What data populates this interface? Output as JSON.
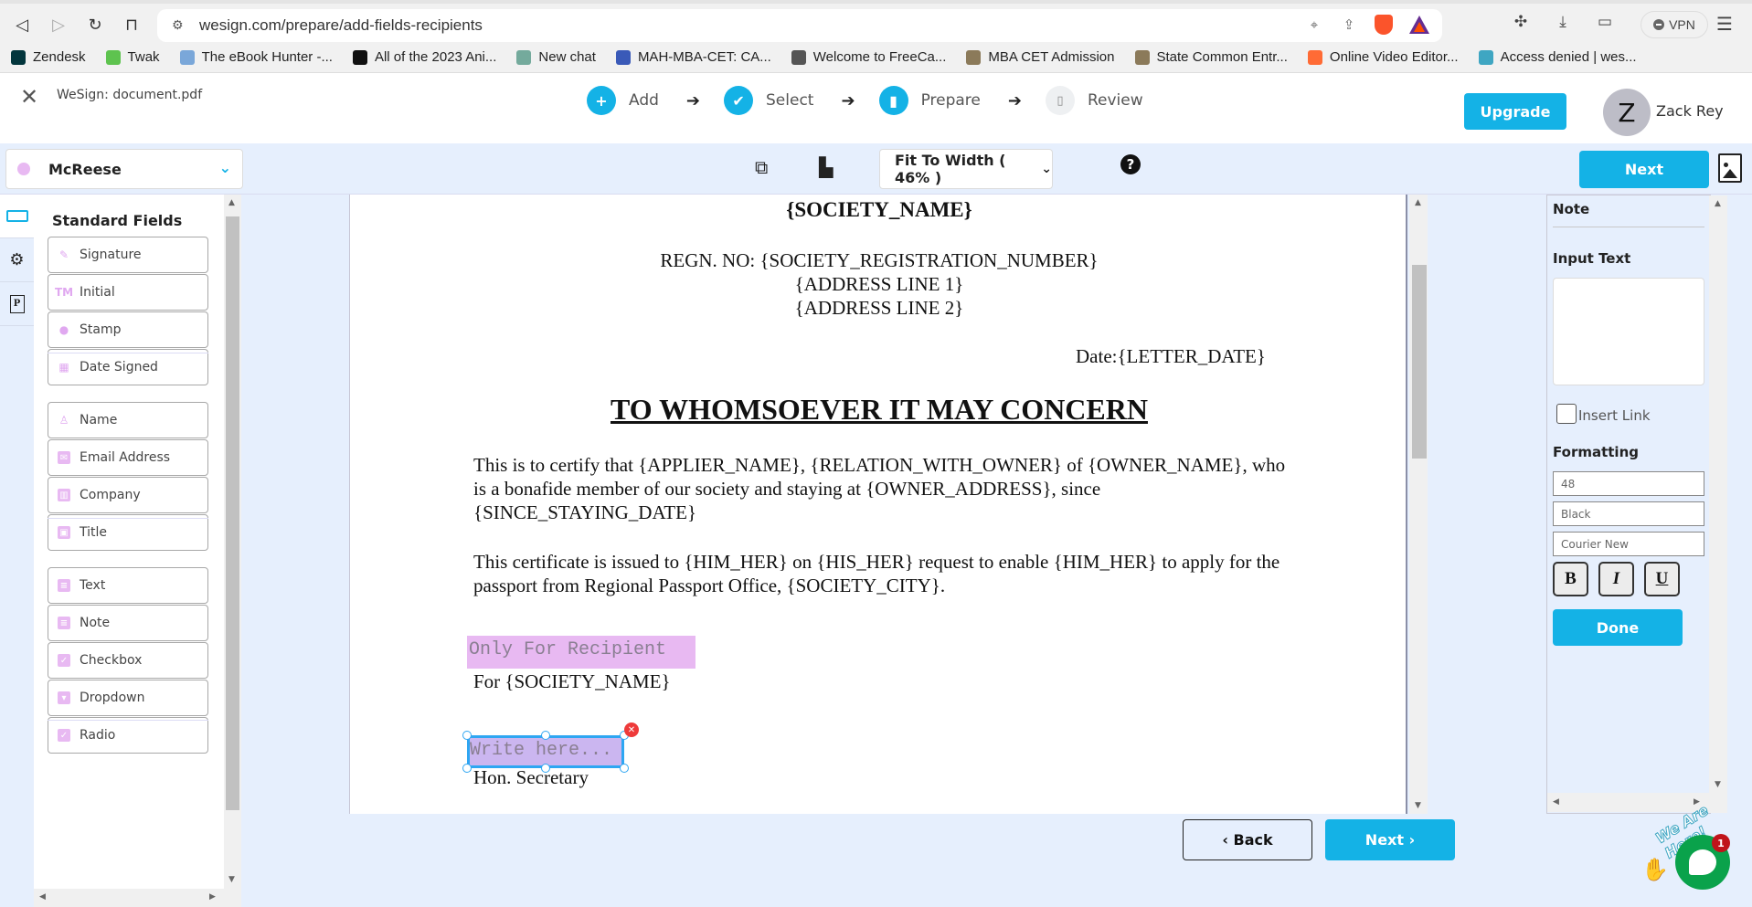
{
  "browser": {
    "url": "wesign.com/prepare/add-fields-recipients",
    "vpn_label": "VPN",
    "bookmarks": [
      {
        "label": "Zendesk",
        "color": "#03363d"
      },
      {
        "label": "Twak",
        "color": "#5ec34f"
      },
      {
        "label": "The eBook Hunter -...",
        "color": "#7aa7d9"
      },
      {
        "label": "All of the 2023 Ani...",
        "color": "#111111"
      },
      {
        "label": "New chat",
        "color": "#74aa9c"
      },
      {
        "label": "MAH-MBA-CET: CA...",
        "color": "#3a5ab8"
      },
      {
        "label": "Welcome to FreeCa...",
        "color": "#555555"
      },
      {
        "label": "MBA CET Admission",
        "color": "#8b7a5a"
      },
      {
        "label": "State Common Entr...",
        "color": "#8b7a5a"
      },
      {
        "label": "Online Video Editor...",
        "color": "#ff6b35"
      },
      {
        "label": "Access denied | wes...",
        "color": "#3fa6c2"
      }
    ]
  },
  "header": {
    "doc_title": "WeSign: document.pdf",
    "steps": [
      {
        "label": "Add",
        "icon": "plus-circle-icon",
        "glyph": "+",
        "state": "done"
      },
      {
        "label": "Select",
        "icon": "check-circle-icon",
        "glyph": "✔",
        "state": "done"
      },
      {
        "label": "Prepare",
        "icon": "file-icon",
        "glyph": "▮",
        "state": "active"
      },
      {
        "label": "Review",
        "icon": "review-doc-icon",
        "glyph": "▯",
        "state": "inactive"
      }
    ],
    "upgrade_label": "Upgrade",
    "avatar_initial": "Z",
    "user_name": "Zack Rey"
  },
  "toolbar": {
    "recipient": "McReese",
    "recipient_color": "#e8b9f2",
    "zoom_label": "Fit To Width ( 46% )",
    "help_glyph": "?",
    "next_label": "Next"
  },
  "sidebar": {
    "heading": "Standard Fields",
    "groups": [
      [
        {
          "label": "Signature",
          "icon": "pen-icon"
        },
        {
          "label": "Initial",
          "icon": "tm-icon"
        },
        {
          "label": "Stamp",
          "icon": "stamp-icon"
        },
        {
          "label": "Date Signed",
          "icon": "calendar-icon"
        }
      ],
      [
        {
          "label": "Name",
          "icon": "user-icon"
        },
        {
          "label": "Email Address",
          "icon": "envelope-icon"
        },
        {
          "label": "Company",
          "icon": "building-icon"
        },
        {
          "label": "Title",
          "icon": "briefcase-icon"
        }
      ],
      [
        {
          "label": "Text",
          "icon": "text-doc-icon"
        },
        {
          "label": "Note",
          "icon": "note-doc-icon"
        },
        {
          "label": "Checkbox",
          "icon": "checkbox-icon"
        },
        {
          "label": "Dropdown",
          "icon": "dropdown-icon"
        },
        {
          "label": "Radio",
          "icon": "radio-icon"
        }
      ]
    ]
  },
  "document": {
    "society_name": "{SOCIETY_NAME}",
    "regn": "REGN. NO: {SOCIETY_REGISTRATION_NUMBER}",
    "address1": "{ADDRESS LINE 1}",
    "address2": "{ADDRESS LINE 2}",
    "date": "Date:{LETTER_DATE}",
    "heading": "TO WHOMSOEVER IT MAY CONCERN",
    "para1": "This is to certify that {APPLIER_NAME}, {RELATION_WITH_OWNER} of {OWNER_NAME}, who is a bonafide member of our society and staying at {OWNER_ADDRESS}, since {SINCE_STAYING_DATE}",
    "para2": "This certificate is issued to {HIM_HER} on {HIS_HER} request to enable {HIM_HER} to apply for the passport from Regional Passport Office, {SOCIETY_CITY}.",
    "recipient_field": "Only For Recipient",
    "for_society": "For {SOCIETY_NAME}",
    "note_placeholder": "Write here...",
    "signatory": "Hon. Secretary"
  },
  "footer": {
    "back_label": "Back",
    "next_label": "Next"
  },
  "properties": {
    "title": "Note",
    "input_label": "Input Text",
    "input_value": "",
    "insert_link_label": "Insert Link",
    "insert_link_checked": false,
    "formatting_label": "Formatting",
    "font_size": "48",
    "color": "Black",
    "font": "Courier New",
    "bold": "B",
    "italic": "I",
    "underline": "U",
    "done_label": "Done"
  },
  "chat": {
    "tagline": "We Are Here!",
    "badge_count": "1"
  }
}
